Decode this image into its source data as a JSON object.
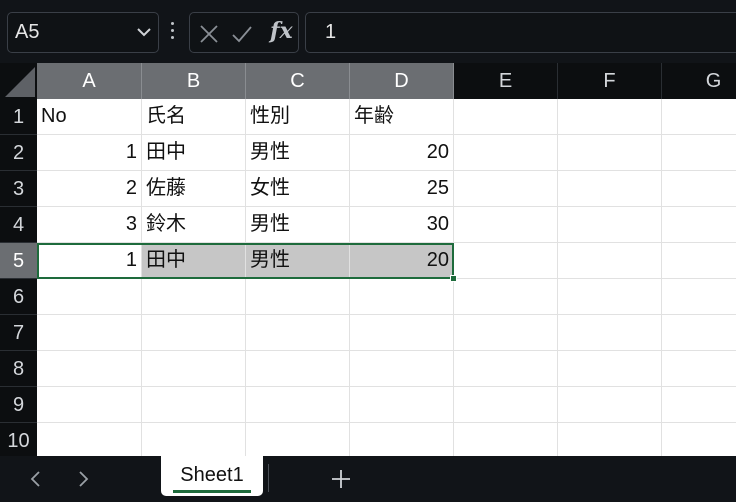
{
  "formula_bar": {
    "name_box": "A5",
    "fx_label": "fx",
    "formula_value": "1"
  },
  "columns": [
    "A",
    "B",
    "C",
    "D",
    "E",
    "F",
    "G"
  ],
  "rows": [
    "1",
    "2",
    "3",
    "4",
    "5",
    "6",
    "7",
    "8",
    "9",
    "10"
  ],
  "table": [
    [
      "No",
      "氏名",
      "性別",
      "年齢"
    ],
    [
      "1",
      "田中",
      "男性",
      "20"
    ],
    [
      "2",
      "佐藤",
      "女性",
      "25"
    ],
    [
      "3",
      "鈴木",
      "男性",
      "30"
    ],
    [
      "1",
      "田中",
      "男性",
      "20"
    ]
  ],
  "sheet_tabs": {
    "active": "Sheet1"
  },
  "colors": {
    "accent_green": "#1e6b3c",
    "selected_header": "#6b6e72",
    "highlight_fill": "#c6c6c6"
  },
  "icons": [
    "chevron-down-icon",
    "more-icon",
    "cancel-icon",
    "confirm-icon",
    "fx-icon",
    "chevron-left-icon",
    "chevron-right-icon",
    "plus-icon"
  ]
}
